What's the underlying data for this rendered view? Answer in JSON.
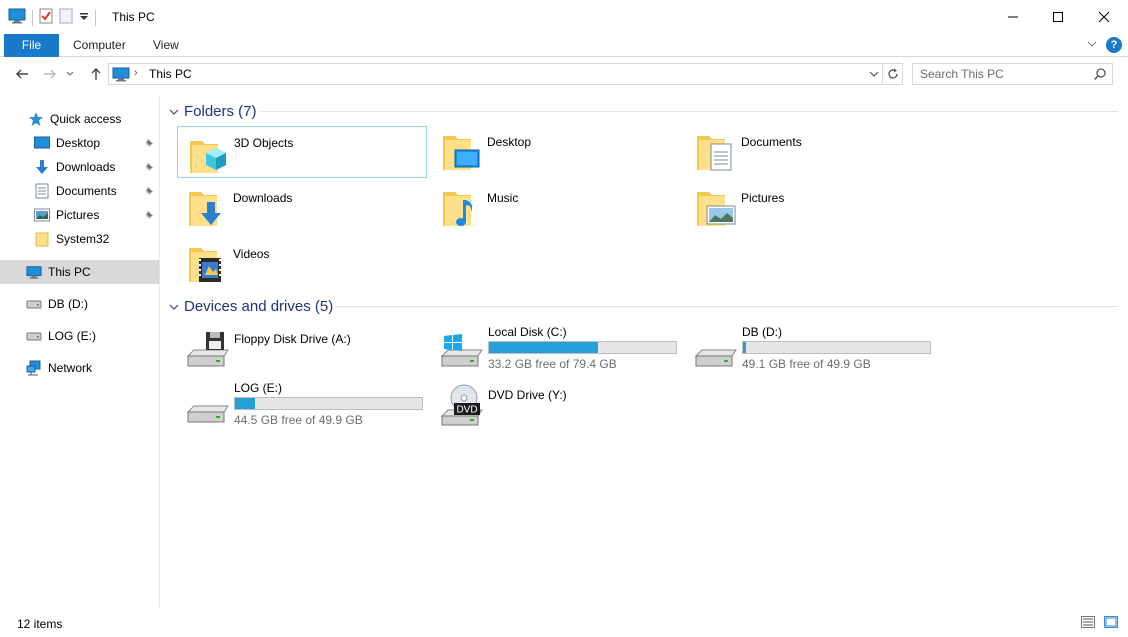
{
  "window": {
    "title": "This PC"
  },
  "ribbon": {
    "tabs": [
      {
        "label": "File"
      },
      {
        "label": "Computer"
      },
      {
        "label": "View"
      }
    ],
    "help": "?"
  },
  "address": {
    "location": "This PC"
  },
  "search": {
    "placeholder": "Search This PC"
  },
  "sidebar": {
    "quick_access": "Quick access",
    "items": [
      {
        "label": "Desktop",
        "icon": "desktop-icon",
        "pinned": true
      },
      {
        "label": "Downloads",
        "icon": "downloads-icon",
        "pinned": true
      },
      {
        "label": "Documents",
        "icon": "documents-icon",
        "pinned": true
      },
      {
        "label": "Pictures",
        "icon": "pictures-icon",
        "pinned": true
      },
      {
        "label": "System32",
        "icon": "folder-icon",
        "pinned": false
      }
    ],
    "this_pc": "This PC",
    "drives": [
      {
        "label": "DB (D:)"
      },
      {
        "label": "LOG (E:)"
      }
    ],
    "network": "Network"
  },
  "folders": {
    "header": "Folders (7)",
    "items": [
      {
        "label": "3D Objects",
        "icon": "3d-objects-icon"
      },
      {
        "label": "Desktop",
        "icon": "desktop-folder-icon"
      },
      {
        "label": "Documents",
        "icon": "documents-folder-icon"
      },
      {
        "label": "Downloads",
        "icon": "downloads-folder-icon"
      },
      {
        "label": "Music",
        "icon": "music-folder-icon"
      },
      {
        "label": "Pictures",
        "icon": "pictures-folder-icon"
      },
      {
        "label": "Videos",
        "icon": "videos-folder-icon"
      }
    ]
  },
  "devices": {
    "header": "Devices and drives (5)",
    "items": [
      {
        "label": "Floppy Disk Drive (A:)",
        "icon": "floppy-drive-icon"
      },
      {
        "label": "Local Disk (C:)",
        "icon": "windows-drive-icon",
        "free": "33.2 GB free of 79.4 GB",
        "used_fraction": 0.582
      },
      {
        "label": "DB (D:)",
        "icon": "hard-drive-icon",
        "free": "49.1 GB free of 49.9 GB",
        "used_fraction": 0.016
      },
      {
        "label": "LOG (E:)",
        "icon": "hard-drive-icon",
        "free": "44.5 GB free of 49.9 GB",
        "used_fraction": 0.108
      },
      {
        "label": "DVD Drive (Y:)",
        "icon": "dvd-drive-icon",
        "badge": "DVD"
      }
    ]
  },
  "status": {
    "count": "12 items"
  },
  "colors": {
    "accent": "#1979ca",
    "header_text": "#1e3287",
    "bar_fill": "#26a0da",
    "selection": "#d9d9d9"
  }
}
